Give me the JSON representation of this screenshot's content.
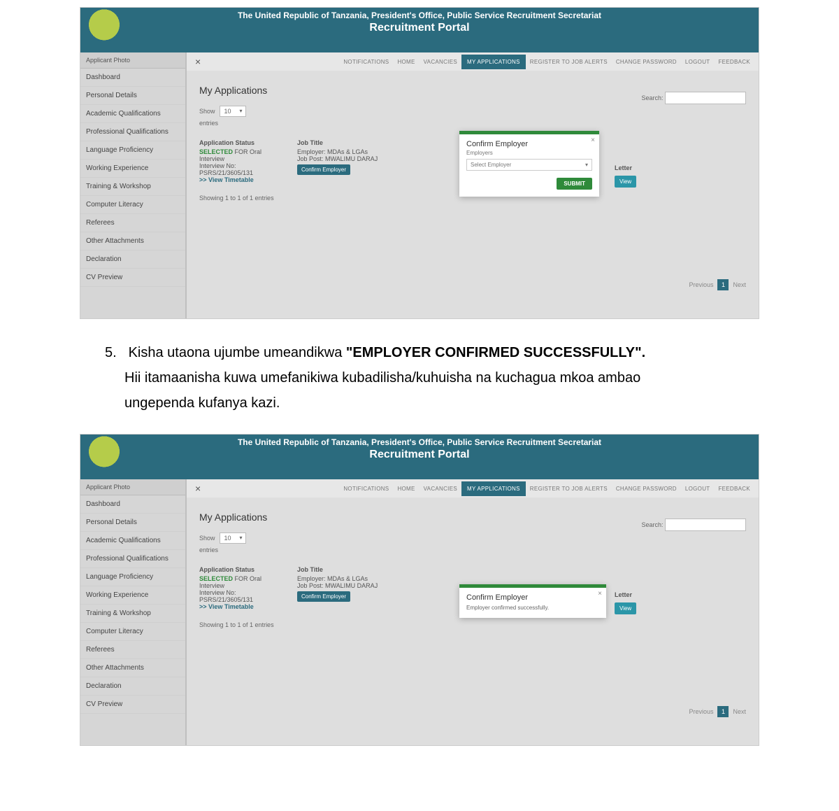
{
  "header": {
    "line1": "The United Republic of Tanzania, President's Office, Public Service Recruitment Secretariat",
    "line2": "Recruitment Portal"
  },
  "sidebar": {
    "applicant_photo": "Applicant Photo",
    "items": [
      "Dashboard",
      "Personal Details",
      "Academic Qualifications",
      "Professional Qualifications",
      "Language Proficiency",
      "Working Experience",
      "Training & Workshop",
      "Computer Literacy",
      "Referees",
      "Other Attachments",
      "Declaration",
      "CV Preview"
    ]
  },
  "nav": {
    "close": "×",
    "links": [
      "NOTIFICATIONS",
      "HOME",
      "VACANCIES",
      "MY APPLICATIONS",
      "REGISTER TO JOB ALERTS",
      "CHANGE PASSWORD",
      "LOGOUT",
      "FEEDBACK"
    ],
    "active_index": 3
  },
  "content": {
    "title": "My Applications",
    "show_label": "Show",
    "show_value": "10",
    "entries_label": "entries",
    "search_label": "Search:",
    "col_status": "Application Status",
    "col_jobtitle": "Job Title",
    "col_letter": "Letter",
    "status_selected": "SELECTED",
    "status_rest": " FOR Oral Interview",
    "interview_no_label": "Interview No:",
    "interview_no": "PSRS/21/3605/131",
    "view_timetable": ">> View Timetable",
    "employer_line": "Employer: MDAs & LGAs",
    "jobpost_line": "Job Post: MWALIMU DARAJ",
    "confirm_btn": "Confirm Employer",
    "view_btn": "View",
    "showing": "Showing 1 to 1 of 1 entries",
    "prev": "Previous",
    "page": "1",
    "next": "Next"
  },
  "modal1": {
    "title": "Confirm Employer",
    "label": "Employers",
    "placeholder": "Select Employer",
    "submit": "SUBMIT"
  },
  "modal2": {
    "title": "Confirm Employer",
    "message": "Employer confirmed successfully."
  },
  "instruction": {
    "number": "5.",
    "lead": "Kisha utaona ujumbe umeandikwa ",
    "bold": "\"EMPLOYER CONFIRMED SUCCESSFULLY\".",
    "line2": "Hii itamaanisha kuwa umefanikiwa kubadilisha/kuhuisha na kuchagua mkoa ambao",
    "line3": "ungependa kufanya kazi."
  }
}
